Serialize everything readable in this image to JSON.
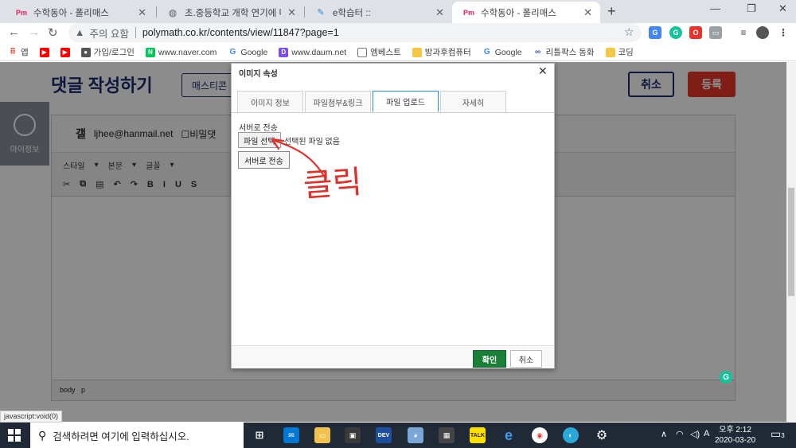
{
  "browser": {
    "tabs": [
      {
        "favicon": "Pm",
        "title": "수학동아 - 폴리매스",
        "active": false
      },
      {
        "favicon": "globe-icon",
        "title": "초.중등학교 개학 연기에 따른 온",
        "active": false
      },
      {
        "favicon": "e-icon",
        "title": "e학습터 ::",
        "active": false
      },
      {
        "favicon": "Pm",
        "title": "수학동아 - 폴리매스",
        "active": true
      }
    ],
    "new_tab": "+",
    "security_label": "주의 요함",
    "url": "polymath.co.kr/contents/view/11847?page=1",
    "bookmarks": [
      {
        "label": "앱",
        "icon": "apps-icon"
      },
      {
        "label": "",
        "icon": "youtube-icon"
      },
      {
        "label": "",
        "icon": "youtube-icon"
      },
      {
        "label": "가입/로그인",
        "icon": "person-icon"
      },
      {
        "label": "www.naver.com",
        "icon": "naver-icon"
      },
      {
        "label": "Google",
        "icon": "google-icon"
      },
      {
        "label": "www.daum.net",
        "icon": "daum-icon"
      },
      {
        "label": "엠베스트",
        "icon": "page-icon"
      },
      {
        "label": "방과후컴퓨터",
        "icon": "folder-icon"
      },
      {
        "label": "Google",
        "icon": "google-icon"
      },
      {
        "label": "리틀팍스 동화",
        "icon": "littlefox-icon"
      },
      {
        "label": "코딩",
        "icon": "folder-icon"
      }
    ]
  },
  "page": {
    "title": "댓글 작성하기",
    "mastcon_label": "매스티콘",
    "cancel_label": "취소",
    "register_label": "등록",
    "myinfo_label": "마이정보",
    "nickname": "갤",
    "email": "ljhee@hanmail.net",
    "secret_label": "비밀댓",
    "toolbar_row1": [
      "스타일",
      "본문",
      "글꼴"
    ],
    "toolbar_row2": [
      "B",
      "I",
      "U",
      "S"
    ],
    "footer_path": [
      "body",
      "p"
    ]
  },
  "dialog": {
    "title": "이미지 속성",
    "tabs": [
      "이미지 정보",
      "파일첨부&링크",
      "파일 업로드",
      "자세히"
    ],
    "active_tab": "파일 업로드",
    "send_label": "서버로 전송",
    "choose_file_label": "파일 선택",
    "no_file_text": "선택된 파일 없음",
    "send_button": "서버로 전송",
    "ok_label": "확인",
    "cancel_label": "취소"
  },
  "annotation": {
    "text": "클릭",
    "color": "#e0302a"
  },
  "status_text": "javascript:void(0)",
  "taskbar": {
    "search_placeholder": "검색하려면 여기에 입력하십시오.",
    "time": "오후 2:12",
    "date": "2020-03-20",
    "notification_count": "3"
  },
  "colors": {
    "brand_navy": "#1a2a6c",
    "register_red": "#e6372a",
    "ok_green": "#1a7f37",
    "active_tab_border": "#2b8ad8"
  }
}
